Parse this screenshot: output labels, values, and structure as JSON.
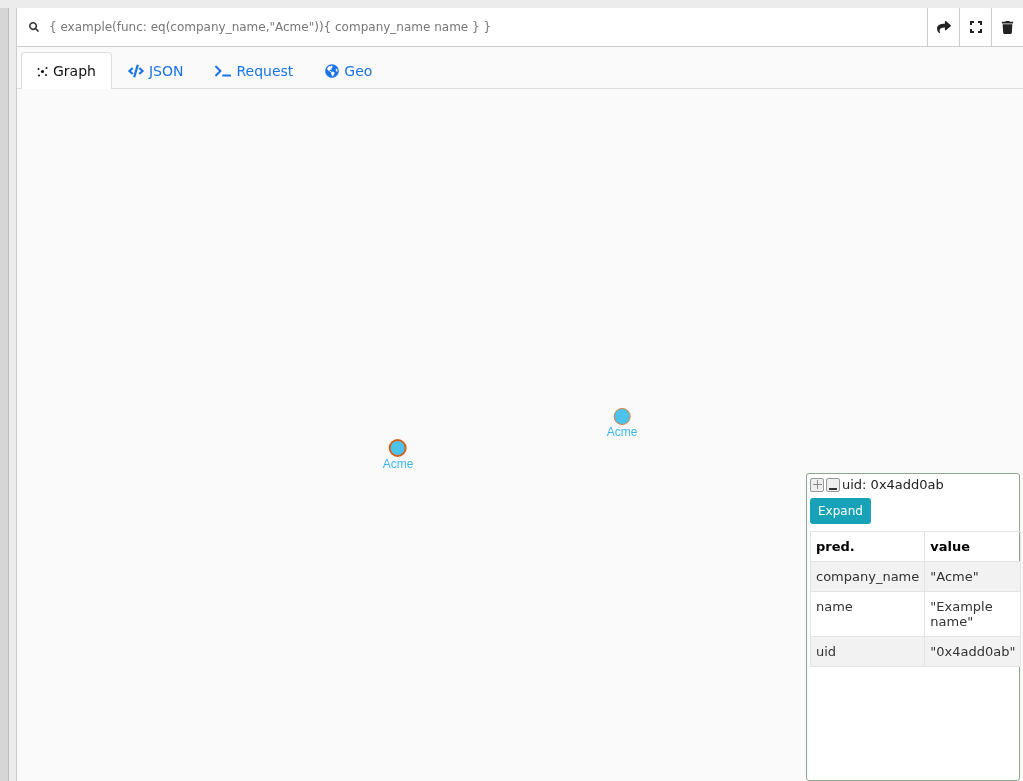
{
  "query": "{ example(func: eq(company_name,\"Acme\")){ company_name name } }",
  "tabs": [
    {
      "kind": "graph",
      "label": "Graph",
      "selected": true
    },
    {
      "kind": "json",
      "label": "JSON",
      "selected": false
    },
    {
      "kind": "request",
      "label": "Request",
      "selected": false
    },
    {
      "kind": "geo",
      "label": "Geo",
      "selected": false
    }
  ],
  "nodes": [
    {
      "label": "Acme",
      "selected": true
    },
    {
      "label": "Acme",
      "selected": false
    }
  ],
  "info_panel": {
    "title": "uid: 0x4add0ab",
    "button": "Expand",
    "columns": [
      "pred.",
      "value"
    ],
    "rows": [
      [
        "company_name",
        "\"Acme\""
      ],
      [
        "name",
        "\"Example name\""
      ],
      [
        "uid",
        "\"0x4add0ab\""
      ]
    ]
  }
}
